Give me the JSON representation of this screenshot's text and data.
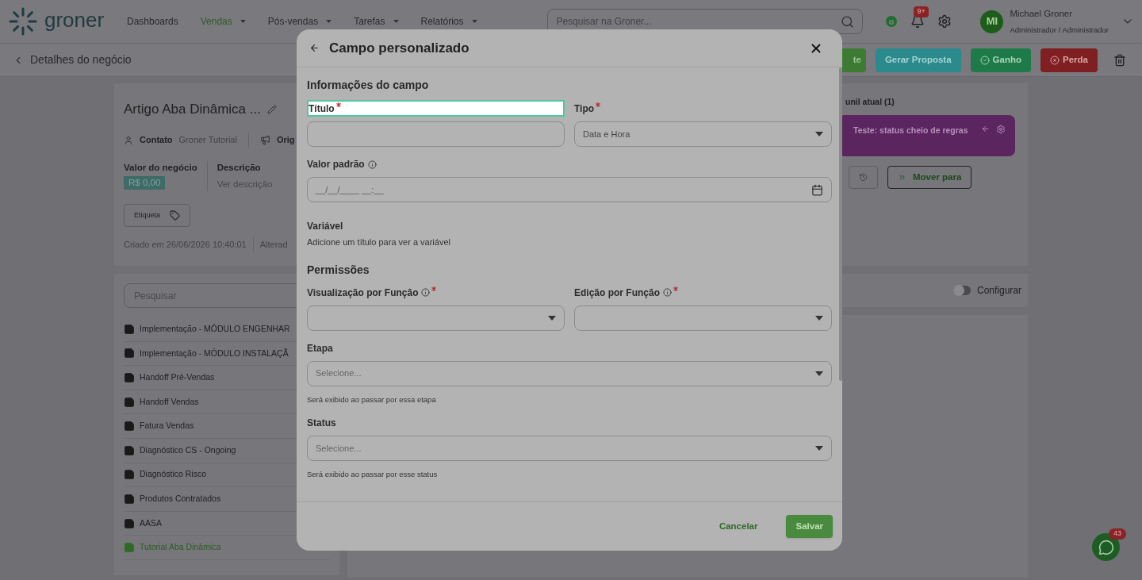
{
  "nav": {
    "logo": "groner",
    "items": [
      {
        "label": "Dashboards",
        "selected": false,
        "has_menu": false
      },
      {
        "label": "Vendas",
        "selected": true,
        "has_menu": true
      },
      {
        "label": "Pós-vendas",
        "selected": false,
        "has_menu": true
      },
      {
        "label": "Tarefas",
        "selected": false,
        "has_menu": true
      },
      {
        "label": "Relatórios",
        "selected": false,
        "has_menu": true
      }
    ],
    "search": {
      "placeholder": "Pesquisar na Groner..."
    },
    "notification_badge": "9+",
    "user": {
      "initials": "MI",
      "name": "Michael Groner",
      "role": "Administrador / Administrador"
    }
  },
  "subheader": {
    "title": "Detalhes do negócio",
    "actions": [
      {
        "label": "te",
        "kind": "green"
      },
      {
        "label": "Gerar Proposta",
        "kind": "teal"
      },
      {
        "label": "Ganho",
        "kind": "won"
      },
      {
        "label": "Perda",
        "kind": "lost"
      }
    ]
  },
  "deal": {
    "title": "Artigo Aba Dinâmica ...",
    "contact_label": "Contato",
    "contact_value": "Groner Tutorial",
    "origin_label": "Orig",
    "value_label": "Valor do negócio",
    "value": "R$ 0,00",
    "description_label": "Descrição",
    "description_link": "Ver descrição",
    "tag_button": "Etiqueta",
    "created": "Criado em 26/06/2026 10:40:01",
    "updated": "Alterad"
  },
  "stages": {
    "search_placeholder": "Pesquisar",
    "items": [
      {
        "label": "Implementação - MÓDULO ENGENHAR",
        "selected": false
      },
      {
        "label": "Implementação - MÓDULO INSTALAÇÃ",
        "selected": false
      },
      {
        "label": "Handoff Pré-Vendas",
        "selected": false
      },
      {
        "label": "Handoff Vendas",
        "selected": false
      },
      {
        "label": "Fatura Vendas",
        "selected": false
      },
      {
        "label": "Diagnóstico CS - Ongoing",
        "selected": false
      },
      {
        "label": "Diagnóstico Risco",
        "selected": false
      },
      {
        "label": "Produtos Contratados",
        "selected": false
      },
      {
        "label": "AASA",
        "selected": false
      },
      {
        "label": "Tutorial Aba Dinâmica",
        "selected": true
      }
    ]
  },
  "funnel": {
    "heading": "unil atual (1)",
    "status": "Teste: status cheio de regras",
    "move_button": "Mover para"
  },
  "configure": {
    "label": "Configurar",
    "on": false
  },
  "modal": {
    "title": "Campo personalizado",
    "info_heading": "Informações do campo",
    "titulo": {
      "label": "Título",
      "required": true,
      "highlighted": true
    },
    "tipo": {
      "label": "Tipo",
      "required": true,
      "value": "Data e Hora"
    },
    "default_value": {
      "label": "Valor padrão",
      "placeholder": "__/__/____ __:__"
    },
    "variable": {
      "label": "Variável",
      "hint": "Adicione um título para ver a variável"
    },
    "permissions_heading": "Permissões",
    "view_roles": {
      "label": "Visualização por Função",
      "required": true
    },
    "edit_roles": {
      "label": "Edição por Função",
      "required": true
    },
    "stage": {
      "label": "Etapa",
      "placeholder": "Selecione...",
      "help": "Será exibido ao passar por essa etapa"
    },
    "status": {
      "label": "Status",
      "placeholder": "Selecione...",
      "help": "Será exibido ao passar por esse status"
    },
    "cancel": "Cancelar",
    "save": "Salvar"
  },
  "chat_badge": "43"
}
